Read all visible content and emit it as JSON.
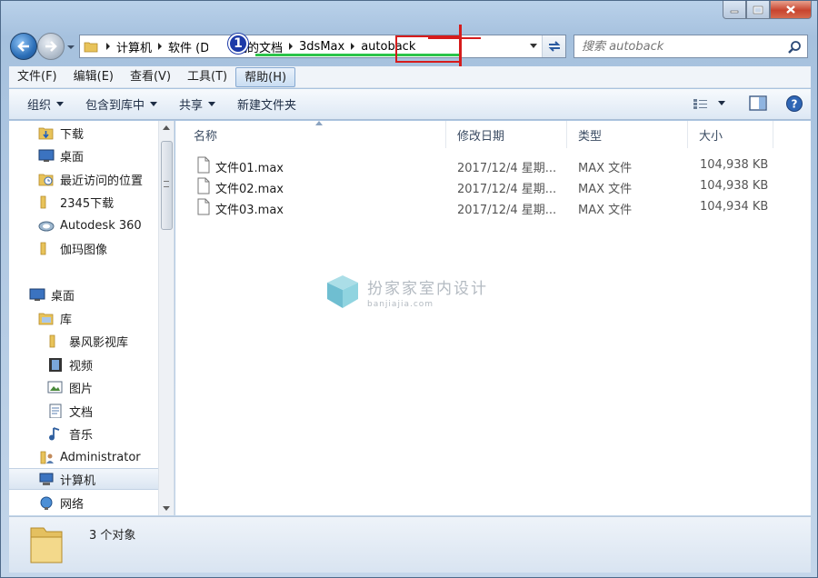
{
  "address": {
    "crumbs": [
      "计算机",
      "软件 (D:)",
      "我的文档",
      "3dsMax",
      "autoback"
    ]
  },
  "search": {
    "placeholder": "搜索 autoback"
  },
  "annotation": {
    "badge": "1"
  },
  "menu": [
    "文件(F)",
    "编辑(E)",
    "查看(V)",
    "工具(T)",
    "帮助(H)"
  ],
  "toolbar": {
    "organize": "组织",
    "include": "包含到库中",
    "share": "共享",
    "new_folder": "新建文件夹"
  },
  "nav": {
    "items": [
      {
        "label": "下载",
        "icon": "download-folder-icon"
      },
      {
        "label": "桌面",
        "icon": "desktop-icon"
      },
      {
        "label": "最近访问的位置",
        "icon": "recent-places-icon"
      },
      {
        "label": "2345下载",
        "icon": "folder-icon"
      },
      {
        "label": "Autodesk 360",
        "icon": "autodesk-cloud-icon"
      },
      {
        "label": "伽玛图像",
        "icon": "folder-icon"
      },
      {
        "label": "桌面",
        "icon": "desktop-icon"
      },
      {
        "label": "库",
        "icon": "library-icon"
      },
      {
        "label": "暴风影视库",
        "icon": "folder-icon"
      },
      {
        "label": "视频",
        "icon": "video-library-icon"
      },
      {
        "label": "图片",
        "icon": "pictures-library-icon"
      },
      {
        "label": "文档",
        "icon": "documents-library-icon"
      },
      {
        "label": "音乐",
        "icon": "music-library-icon"
      },
      {
        "label": "Administrator",
        "icon": "user-folder-icon"
      },
      {
        "label": "计算机",
        "icon": "computer-icon"
      },
      {
        "label": "网络",
        "icon": "network-icon"
      }
    ]
  },
  "columns": {
    "name": "名称",
    "date": "修改日期",
    "type": "类型",
    "size": "大小"
  },
  "files": [
    {
      "name": "文件01.max",
      "date": "2017/12/4 星期...",
      "type": "MAX 文件",
      "size": "104,938 KB"
    },
    {
      "name": "文件02.max",
      "date": "2017/12/4 星期...",
      "type": "MAX 文件",
      "size": "104,938 KB"
    },
    {
      "name": "文件03.max",
      "date": "2017/12/4 星期...",
      "type": "MAX 文件",
      "size": "104,934 KB"
    }
  ],
  "watermark": {
    "title": "扮家家室内设计",
    "sub": "banjiajia.com"
  },
  "status": {
    "count": "3 个对象"
  }
}
